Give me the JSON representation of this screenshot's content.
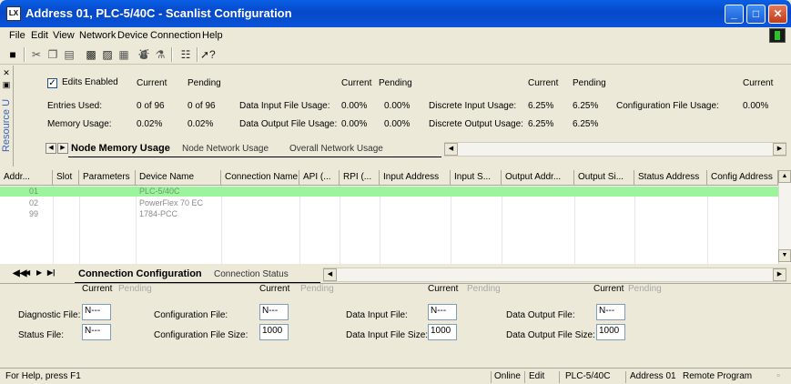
{
  "window": {
    "title": "Address 01, PLC-5/40C - Scanlist Configuration",
    "app_icon": "rslinx-icon",
    "min": "_",
    "max": "□",
    "close": "✕"
  },
  "menu": [
    "File",
    "Edit",
    "View",
    "Network",
    "Device",
    "Connection",
    "Help"
  ],
  "dock": {
    "label": "Resource U"
  },
  "usage": {
    "edits_enabled": "Edits Enabled",
    "checked": true,
    "col_current": "Current",
    "col_pending": "Pending",
    "entries_used_label": "Entries Used:",
    "entries_used_current": "0 of 96",
    "entries_used_pending": "0 of 96",
    "memory_usage_label": "Memory Usage:",
    "memory_usage_current": "0.02%",
    "memory_usage_pending": "0.02%",
    "data_input_label": "Data Input File Usage:",
    "data_input_current": "0.00%",
    "data_input_pending": "0.00%",
    "data_output_label": "Data Output File Usage:",
    "data_output_current": "0.00%",
    "data_output_pending": "0.00%",
    "discrete_input_label": "Discrete Input Usage:",
    "discrete_input_current": "6.25%",
    "discrete_input_pending": "6.25%",
    "discrete_output_label": "Discrete Output Usage:",
    "discrete_output_current": "6.25%",
    "discrete_output_pending": "6.25%",
    "config_file_label": "Configuration File Usage:",
    "config_file_current": "0.00%",
    "tabs": [
      "Node Memory Usage",
      "Node Network Usage",
      "Overall Network Usage"
    ]
  },
  "grid": {
    "columns": [
      "Addr...",
      "Slot",
      "Parameters",
      "Device Name",
      "Connection Name",
      "API (...",
      "RPI (...",
      "Input Address",
      "Input S...",
      "Output Addr...",
      "Output Si...",
      "Status Address",
      "Config Address"
    ],
    "rows": [
      {
        "addr": "01",
        "device": "PLC-5/40C"
      },
      {
        "addr": "02",
        "device": "PowerFlex 70 EC"
      },
      {
        "addr": "99",
        "device": "1784-PCC"
      }
    ]
  },
  "conn_tabs": [
    "Connection Configuration",
    "Connection Status"
  ],
  "conn": {
    "current": "Current",
    "pending": "Pending",
    "diagnostic_file_label": "Diagnostic File:",
    "diagnostic_file": "N---",
    "status_file_label": "Status File:",
    "status_file": "N---",
    "config_file_label": "Configuration File:",
    "config_file": "N---",
    "config_file_size_label": "Configuration File Size:",
    "config_file_size": "1000",
    "data_input_file_label": "Data Input File:",
    "data_input_file": "N---",
    "data_input_size_label": "Data Input File Size:",
    "data_input_size": "1000",
    "data_output_file_label": "Data Output File:",
    "data_output_file": "N---",
    "data_output_size_label": "Data Output File Size:",
    "data_output_size": "1000"
  },
  "status": {
    "help": "For Help, press F1",
    "online": "Online",
    "edit": "Edit",
    "processor": "PLC-5/40C",
    "address": "Address 01",
    "mode": "Remote Program"
  },
  "colors": {
    "selected_row": "#9cf59c",
    "title_blue": "#0a54da",
    "dock_label": "#3a62b8"
  }
}
